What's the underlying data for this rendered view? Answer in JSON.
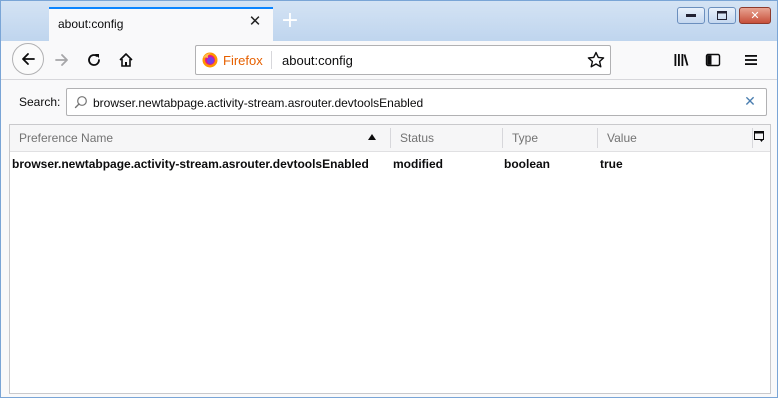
{
  "tab": {
    "title": "about:config",
    "close_glyph": "✕",
    "new_tab_glyph": "+"
  },
  "window_controls": {
    "minimize": "▬",
    "maximize": "❐",
    "close": "✕"
  },
  "navbar": {
    "identity_label": "Firefox",
    "url": "about:config",
    "icons": [
      "back-arrow-icon",
      "forward-arrow-icon",
      "reload-icon",
      "home-icon",
      "bookmark-star-icon",
      "library-icon",
      "sidebar-icon",
      "hamburger-menu-icon"
    ]
  },
  "search": {
    "label": "Search:",
    "value": "browser.newtabpage.activity-stream.asrouter.devtoolsEnabled",
    "clear_glyph": "✕"
  },
  "table": {
    "columns": [
      "Preference Name",
      "Status",
      "Type",
      "Value"
    ],
    "sort_column": "Preference Name",
    "sort_direction": "ascending",
    "rows": [
      {
        "name": "browser.newtabpage.activity-stream.asrouter.devtoolsEnabled",
        "status": "modified",
        "type": "boolean",
        "value": "true"
      }
    ]
  },
  "colors": {
    "accent_blue": "#0a84ff",
    "firefox_orange": "#e66000",
    "window_frame": "#bcd4ee"
  }
}
